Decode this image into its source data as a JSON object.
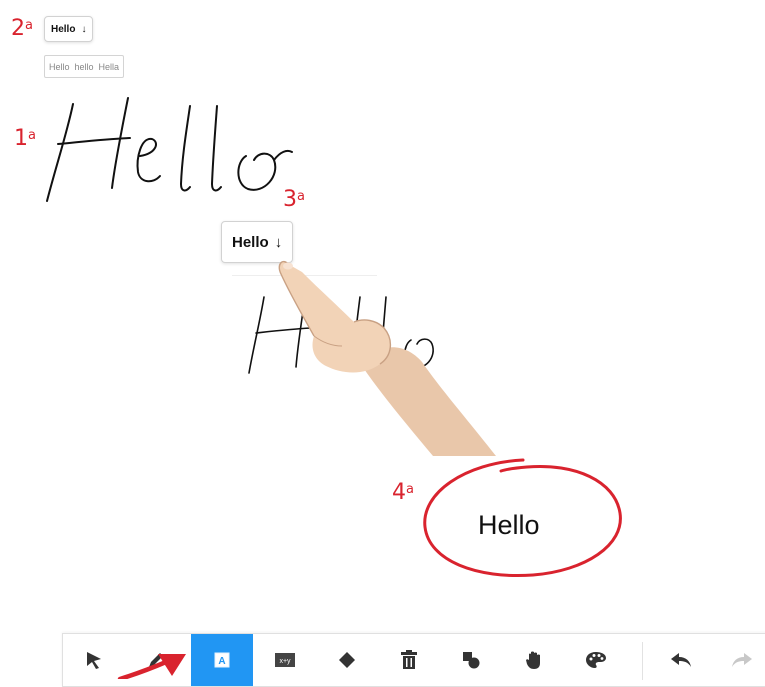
{
  "steps": {
    "one": {
      "num": "1",
      "sup": "a"
    },
    "two": {
      "num": "2",
      "sup": "a"
    },
    "three": {
      "num": "3",
      "sup": "a"
    },
    "four": {
      "num": "4",
      "sup": "a"
    }
  },
  "small_chip": {
    "word": "Hello",
    "arrow": "↓"
  },
  "suggestions": [
    "Hello",
    "hello",
    "Hella"
  ],
  "large_chip": {
    "word": "Hello",
    "arrow": "↓"
  },
  "recognized_text": "Hello",
  "toolbar": {
    "tools": [
      {
        "name": "select",
        "icon": "cursor-arrow-icon"
      },
      {
        "name": "pen",
        "icon": "pen-icon"
      },
      {
        "name": "text-recognition",
        "icon": "text-box-icon",
        "label": "A",
        "active": true
      },
      {
        "name": "formula",
        "icon": "formula-icon",
        "label": "x+y"
      },
      {
        "name": "eraser",
        "icon": "eraser-icon"
      },
      {
        "name": "delete",
        "icon": "trash-icon"
      },
      {
        "name": "shapes",
        "icon": "shapes-icon"
      },
      {
        "name": "pan",
        "icon": "hand-icon"
      },
      {
        "name": "color",
        "icon": "palette-icon"
      },
      {
        "name": "undo",
        "icon": "undo-icon"
      },
      {
        "name": "redo",
        "icon": "redo-icon"
      }
    ],
    "active_color": "#2196f3"
  },
  "colors": {
    "annotation_red": "#d9232e",
    "ink": "#111111"
  }
}
